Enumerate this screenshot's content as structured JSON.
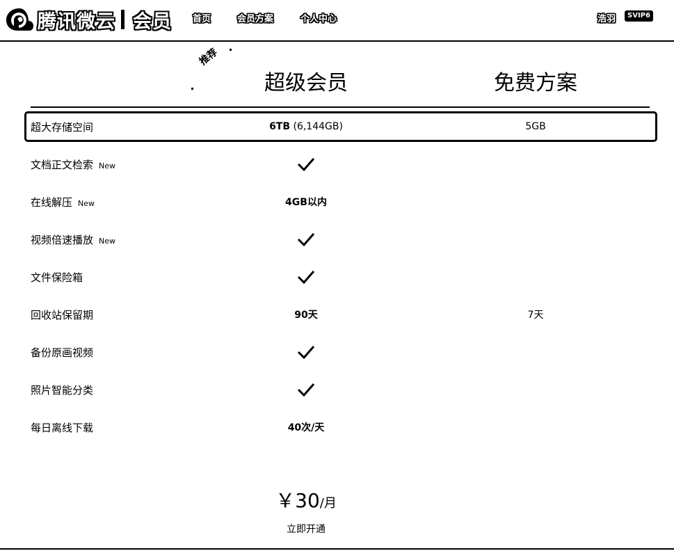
{
  "header": {
    "brand": "腾讯微云",
    "section": "会员",
    "nav": [
      "首页",
      "会员方案",
      "个人中心"
    ],
    "user_name": "浩羽",
    "vip_level": "SVIP6"
  },
  "plans": {
    "recommend_tag": "推荐",
    "super_title": "超级会员",
    "free_title": "免费方案"
  },
  "features": [
    {
      "name": "超大存储空间",
      "new": "",
      "super_main": "6TB",
      "super_extra": " (6,144GB)",
      "free": "5GB",
      "super_check": false
    },
    {
      "name": "文档正文检索",
      "new": "New",
      "super_main": "",
      "super_extra": "",
      "free": "",
      "super_check": true
    },
    {
      "name": "在线解压",
      "new": "New",
      "super_main": "4GB以内",
      "super_extra": "",
      "free": "",
      "super_check": false
    },
    {
      "name": "视频倍速播放",
      "new": "New",
      "super_main": "",
      "super_extra": "",
      "free": "",
      "super_check": true
    },
    {
      "name": "文件保险箱",
      "new": "",
      "super_main": "",
      "super_extra": "",
      "free": "",
      "super_check": true
    },
    {
      "name": "回收站保留期",
      "new": "",
      "super_main": "90天",
      "super_extra": "",
      "free": "7天",
      "super_check": false
    },
    {
      "name": "备份原画视频",
      "new": "",
      "super_main": "",
      "super_extra": "",
      "free": "",
      "super_check": true
    },
    {
      "name": "照片智能分类",
      "new": "",
      "super_main": "",
      "super_extra": "",
      "free": "",
      "super_check": true
    },
    {
      "name": "每日离线下载",
      "new": "",
      "super_main": "40次/天",
      "super_extra": "",
      "free": "",
      "super_check": false
    }
  ],
  "price": {
    "amount": "￥30",
    "unit": "/月",
    "action": "立即开通"
  }
}
